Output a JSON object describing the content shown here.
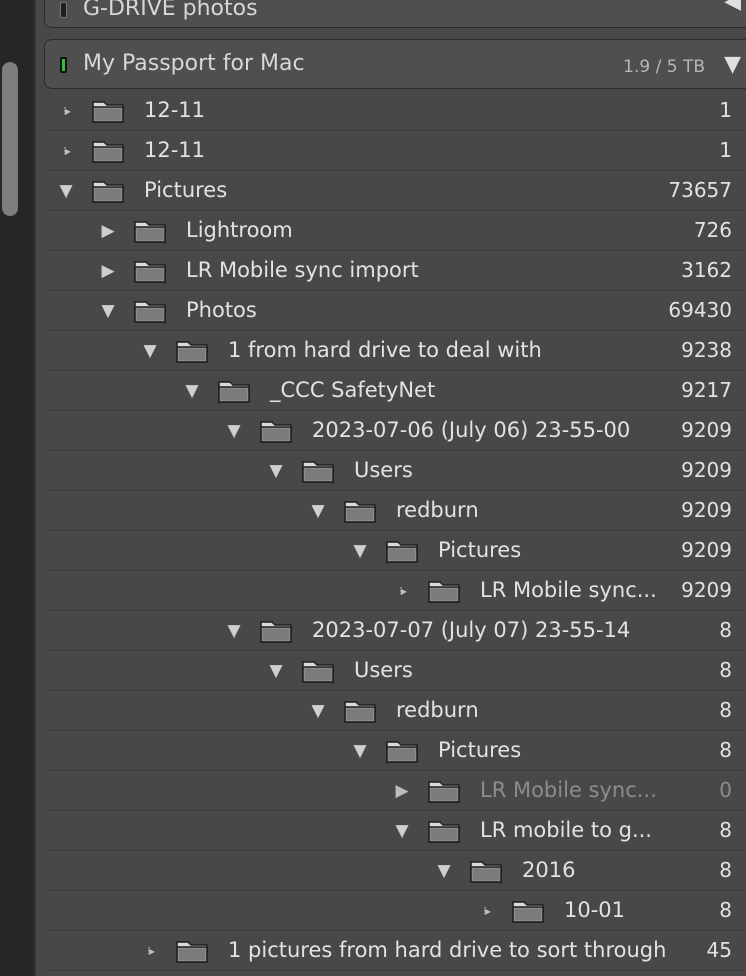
{
  "volumes": {
    "top": {
      "name": "G-DRIVE photos",
      "toggle": "◀"
    },
    "main": {
      "name": "My Passport for Mac",
      "capacity": "1.9 / 5 TB",
      "toggle": "▼"
    }
  },
  "folders": [
    {
      "label": "12-11",
      "count": "1",
      "depth": 0,
      "state": "leaf"
    },
    {
      "label": "12-11",
      "count": "1",
      "depth": 0,
      "state": "leaf"
    },
    {
      "label": "Pictures",
      "count": "73657",
      "depth": 0,
      "state": "expanded"
    },
    {
      "label": "Lightroom",
      "count": "726",
      "depth": 1,
      "state": "collapsed"
    },
    {
      "label": "LR Mobile sync import",
      "count": "3162",
      "depth": 1,
      "state": "collapsed"
    },
    {
      "label": "Photos",
      "count": "69430",
      "depth": 1,
      "state": "expanded"
    },
    {
      "label": "1 from hard drive to deal with",
      "count": "9238",
      "depth": 2,
      "state": "expanded"
    },
    {
      "label": "_CCC SafetyNet",
      "count": "9217",
      "depth": 3,
      "state": "expanded"
    },
    {
      "label": "2023-07-06 (July 06) 23-55-00",
      "count": "9209",
      "depth": 4,
      "state": "expanded"
    },
    {
      "label": "Users",
      "count": "9209",
      "depth": 5,
      "state": "expanded"
    },
    {
      "label": "redburn",
      "count": "9209",
      "depth": 6,
      "state": "expanded"
    },
    {
      "label": "Pictures",
      "count": "9209",
      "depth": 7,
      "state": "expanded"
    },
    {
      "label": "LR Mobile sync...",
      "count": "9209",
      "depth": 8,
      "state": "leaf"
    },
    {
      "label": "2023-07-07 (July 07) 23-55-14",
      "count": "8",
      "depth": 4,
      "state": "expanded"
    },
    {
      "label": "Users",
      "count": "8",
      "depth": 5,
      "state": "expanded"
    },
    {
      "label": "redburn",
      "count": "8",
      "depth": 6,
      "state": "expanded"
    },
    {
      "label": "Pictures",
      "count": "8",
      "depth": 7,
      "state": "expanded"
    },
    {
      "label": "LR Mobile sync...",
      "count": "0",
      "depth": 8,
      "state": "collapsed",
      "dim": true
    },
    {
      "label": "LR mobile to g...",
      "count": "8",
      "depth": 8,
      "state": "expanded"
    },
    {
      "label": "2016",
      "count": "8",
      "depth": 9,
      "state": "expanded"
    },
    {
      "label": "10-01",
      "count": "8",
      "depth": 10,
      "state": "leaf"
    },
    {
      "label": "1 pictures from hard drive to sort through",
      "count": "45",
      "depth": 2,
      "state": "leaf"
    }
  ]
}
